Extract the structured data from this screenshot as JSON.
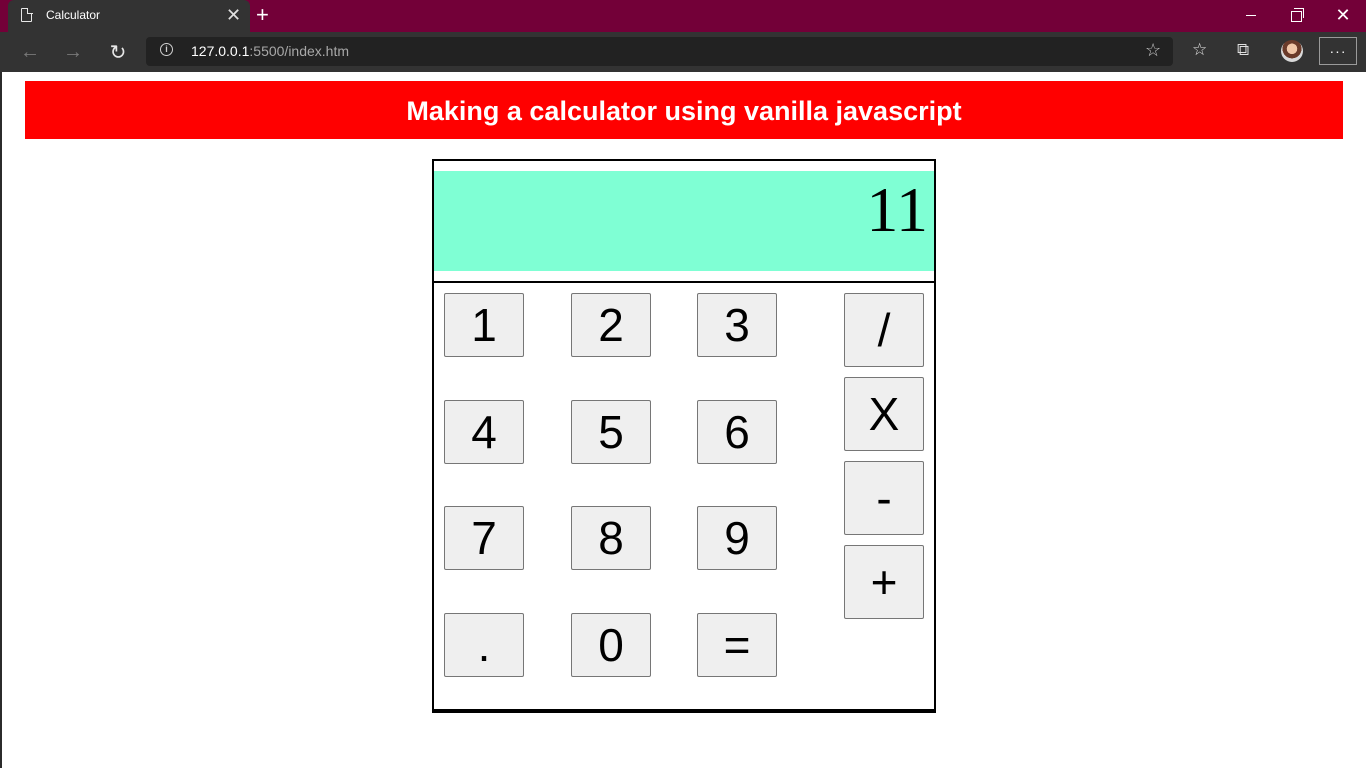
{
  "browser": {
    "tab_title": "Calculator",
    "new_tab_symbol": "+",
    "tab_close_symbol": "✕",
    "url_host": "127.0.0.1",
    "url_rest": ":5500/index.htm",
    "more_menu_symbol": "···",
    "icons": [
      "page-icon",
      "close-icon",
      "back-icon",
      "forward-icon",
      "reload-icon",
      "info-icon",
      "star-icon",
      "favorites-icon",
      "collections-icon",
      "avatar",
      "minimize-icon",
      "maximize-icon",
      "window-close-icon"
    ]
  },
  "page": {
    "heading": "Making a calculator using vanilla javascript"
  },
  "calculator": {
    "display_value": "11",
    "display_color": "#7fffd4",
    "keys": {
      "one": "1",
      "two": "2",
      "three": "3",
      "four": "4",
      "five": "5",
      "six": "6",
      "seven": "7",
      "eight": "8",
      "nine": "9",
      "dot": ".",
      "zero": "0",
      "equals": "=",
      "divide": "/",
      "multiply": "X",
      "subtract": "-",
      "add": "+"
    }
  },
  "colors": {
    "titlebar": "#730038",
    "toolbar": "#333333",
    "header_bg": "#ff0000",
    "header_text": "#ffffff"
  }
}
